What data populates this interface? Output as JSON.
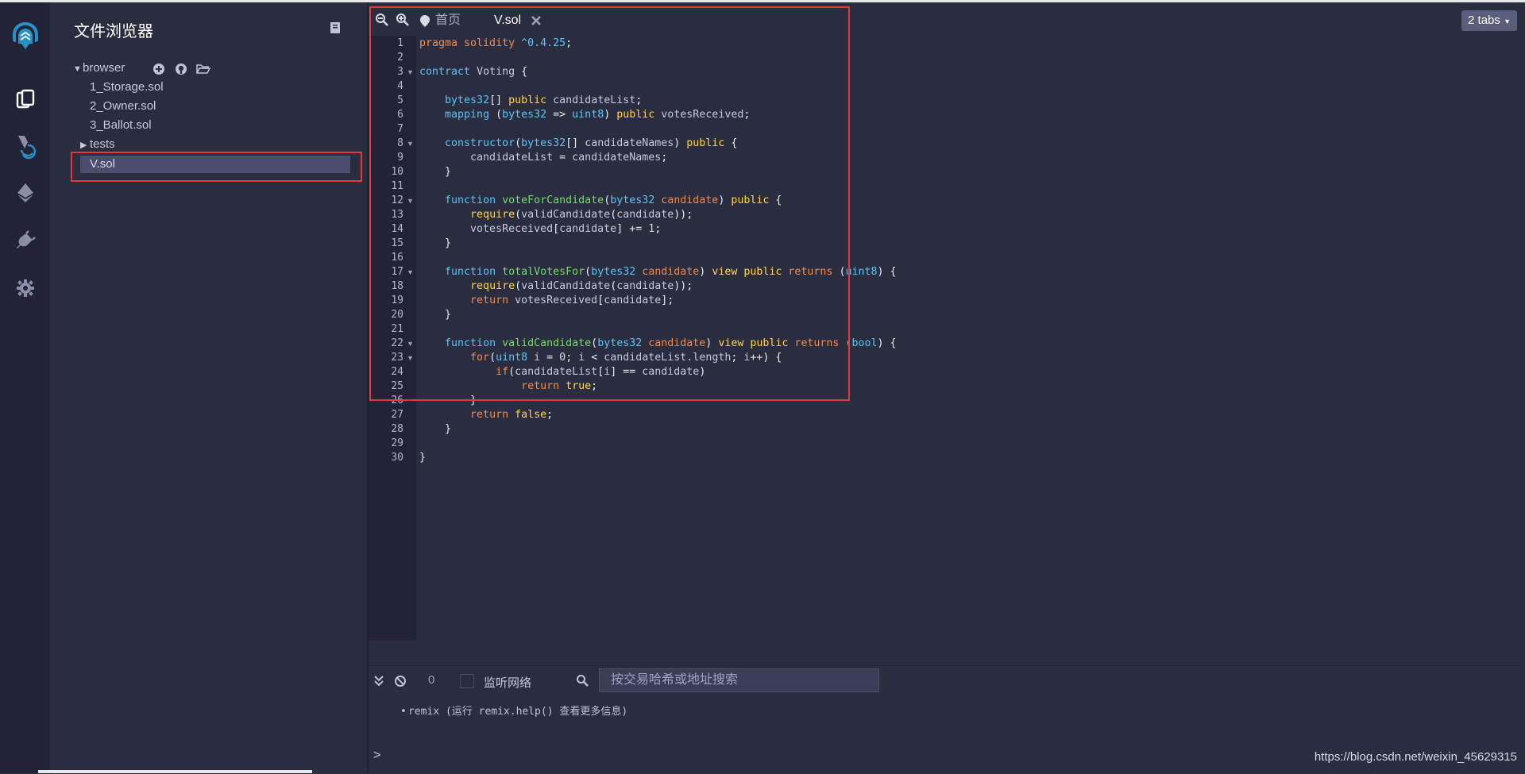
{
  "file_explorer": {
    "title": "文件浏览器",
    "workspace": "browser",
    "files": [
      "1_Storage.sol",
      "2_Owner.sol",
      "3_Ballot.sol"
    ],
    "folder": "tests",
    "selected_file": "V.sol"
  },
  "tabs": {
    "home": "首页",
    "active": "V.sol",
    "count": "2 tabs"
  },
  "code": {
    "lines": [
      [
        [
          "pr",
          "pragma solidity "
        ],
        [
          "ty",
          "^0.4.25"
        ],
        [
          "pn",
          ";"
        ]
      ],
      [],
      [
        [
          "ty",
          "contract "
        ],
        [
          "id",
          "Voting "
        ],
        [
          "pn",
          "{"
        ]
      ],
      [],
      [
        [
          "id",
          "    "
        ],
        [
          "ty",
          "bytes32"
        ],
        [
          "pn",
          "[] "
        ],
        [
          "kw",
          "public "
        ],
        [
          "id",
          "candidateList"
        ],
        [
          "pn",
          ";"
        ]
      ],
      [
        [
          "id",
          "    "
        ],
        [
          "ty",
          "mapping "
        ],
        [
          "pn",
          "("
        ],
        [
          "ty",
          "bytes32 "
        ],
        [
          "pn",
          "=> "
        ],
        [
          "ty",
          "uint8"
        ],
        [
          "pn",
          ") "
        ],
        [
          "kw",
          "public "
        ],
        [
          "id",
          "votesReceived"
        ],
        [
          "pn",
          ";"
        ]
      ],
      [],
      [
        [
          "id",
          "    "
        ],
        [
          "ty",
          "constructor"
        ],
        [
          "pn",
          "("
        ],
        [
          "ty",
          "bytes32"
        ],
        [
          "pn",
          "[] "
        ],
        [
          "id",
          "candidateNames"
        ],
        [
          "pn",
          ") "
        ],
        [
          "kw",
          "public "
        ],
        [
          "pn",
          "{"
        ]
      ],
      [
        [
          "id",
          "        candidateList "
        ],
        [
          "pn",
          "= "
        ],
        [
          "id",
          "candidateNames"
        ],
        [
          "pn",
          ";"
        ]
      ],
      [
        [
          "id",
          "    "
        ],
        [
          "pn",
          "}"
        ]
      ],
      [],
      [
        [
          "id",
          "    "
        ],
        [
          "ty",
          "function "
        ],
        [
          "fn",
          "voteForCandidate"
        ],
        [
          "pn",
          "("
        ],
        [
          "ty",
          "bytes32 "
        ],
        [
          "nm",
          "candidate"
        ],
        [
          "pn",
          ") "
        ],
        [
          "kw",
          "public "
        ],
        [
          "pn",
          "{"
        ]
      ],
      [
        [
          "id",
          "        "
        ],
        [
          "kw",
          "require"
        ],
        [
          "pn",
          "("
        ],
        [
          "id",
          "validCandidate"
        ],
        [
          "pn",
          "("
        ],
        [
          "id",
          "candidate"
        ],
        [
          "pn",
          "));"
        ]
      ],
      [
        [
          "id",
          "        votesReceived"
        ],
        [
          "pn",
          "["
        ],
        [
          "id",
          "candidate"
        ],
        [
          "pn",
          "] += "
        ],
        [
          "ct",
          "1"
        ],
        [
          "pn",
          ";"
        ]
      ],
      [
        [
          "id",
          "    "
        ],
        [
          "pn",
          "}"
        ]
      ],
      [],
      [
        [
          "id",
          "    "
        ],
        [
          "ty",
          "function "
        ],
        [
          "fn",
          "totalVotesFor"
        ],
        [
          "pn",
          "("
        ],
        [
          "ty",
          "bytes32 "
        ],
        [
          "nm",
          "candidate"
        ],
        [
          "pn",
          ") "
        ],
        [
          "kw",
          "view public "
        ],
        [
          "pr",
          "returns "
        ],
        [
          "pn",
          "("
        ],
        [
          "ty",
          "uint8"
        ],
        [
          "pn",
          ") {"
        ]
      ],
      [
        [
          "id",
          "        "
        ],
        [
          "kw",
          "require"
        ],
        [
          "pn",
          "("
        ],
        [
          "id",
          "validCandidate"
        ],
        [
          "pn",
          "("
        ],
        [
          "id",
          "candidate"
        ],
        [
          "pn",
          "));"
        ]
      ],
      [
        [
          "id",
          "        "
        ],
        [
          "pr",
          "return "
        ],
        [
          "id",
          "votesReceived"
        ],
        [
          "pn",
          "["
        ],
        [
          "id",
          "candidate"
        ],
        [
          "pn",
          "];"
        ]
      ],
      [
        [
          "id",
          "    "
        ],
        [
          "pn",
          "}"
        ]
      ],
      [],
      [
        [
          "id",
          "    "
        ],
        [
          "ty",
          "function "
        ],
        [
          "fn",
          "validCandidate"
        ],
        [
          "pn",
          "("
        ],
        [
          "ty",
          "bytes32 "
        ],
        [
          "nm",
          "candidate"
        ],
        [
          "pn",
          ") "
        ],
        [
          "kw",
          "view public "
        ],
        [
          "pr",
          "returns "
        ],
        [
          "pn",
          "("
        ],
        [
          "ty",
          "bool"
        ],
        [
          "pn",
          ") {"
        ]
      ],
      [
        [
          "id",
          "        "
        ],
        [
          "pr",
          "for"
        ],
        [
          "pn",
          "("
        ],
        [
          "ty",
          "uint8 "
        ],
        [
          "id",
          "i "
        ],
        [
          "pn",
          "= "
        ],
        [
          "ct",
          "0"
        ],
        [
          "pn",
          "; "
        ],
        [
          "id",
          "i "
        ],
        [
          "pn",
          "< "
        ],
        [
          "id",
          "candidateList.length"
        ],
        [
          "pn",
          "; "
        ],
        [
          "id",
          "i"
        ],
        [
          "pn",
          "++) {"
        ]
      ],
      [
        [
          "id",
          "            "
        ],
        [
          "pr",
          "if"
        ],
        [
          "pn",
          "("
        ],
        [
          "id",
          "candidateList"
        ],
        [
          "pn",
          "["
        ],
        [
          "id",
          "i"
        ],
        [
          "pn",
          "] == "
        ],
        [
          "id",
          "candidate"
        ],
        [
          "pn",
          ")"
        ]
      ],
      [
        [
          "id",
          "                "
        ],
        [
          "pr",
          "return "
        ],
        [
          "kw",
          "true"
        ],
        [
          "pn",
          ";"
        ]
      ],
      [
        [
          "id",
          "        "
        ],
        [
          "pn",
          "}"
        ]
      ],
      [
        [
          "id",
          "        "
        ],
        [
          "pr",
          "return "
        ],
        [
          "kw",
          "false"
        ],
        [
          "pn",
          ";"
        ]
      ],
      [
        [
          "id",
          "    "
        ],
        [
          "pn",
          "}"
        ]
      ],
      [],
      [
        [
          "pn",
          "}"
        ]
      ]
    ],
    "fold_lines": [
      3,
      8,
      12,
      17,
      22,
      23
    ]
  },
  "terminal": {
    "pending_count": "0",
    "listen_label": "监听网络",
    "search_placeholder": "按交易哈希或地址搜索",
    "log_text": "remix (运行 remix.help() 查看更多信息)",
    "prompt": ">"
  },
  "watermark": "https://blog.csdn.net/weixin_45629315",
  "colors": {
    "highlight_box": "#e03a3a",
    "selected_file_bg": "#4a4e6c",
    "keyword": "#ffd54a",
    "type": "#5ec3f2",
    "function_name": "#79d96c",
    "parameter": "#e78b53"
  },
  "icons": {
    "logo": "remix-logo-icon",
    "file_explorer": "file-explorer-icon",
    "compiler": "solidity-compiler-icon",
    "deploy": "deploy-run-icon",
    "plugin": "plugin-manager-icon",
    "settings": "settings-icon"
  }
}
